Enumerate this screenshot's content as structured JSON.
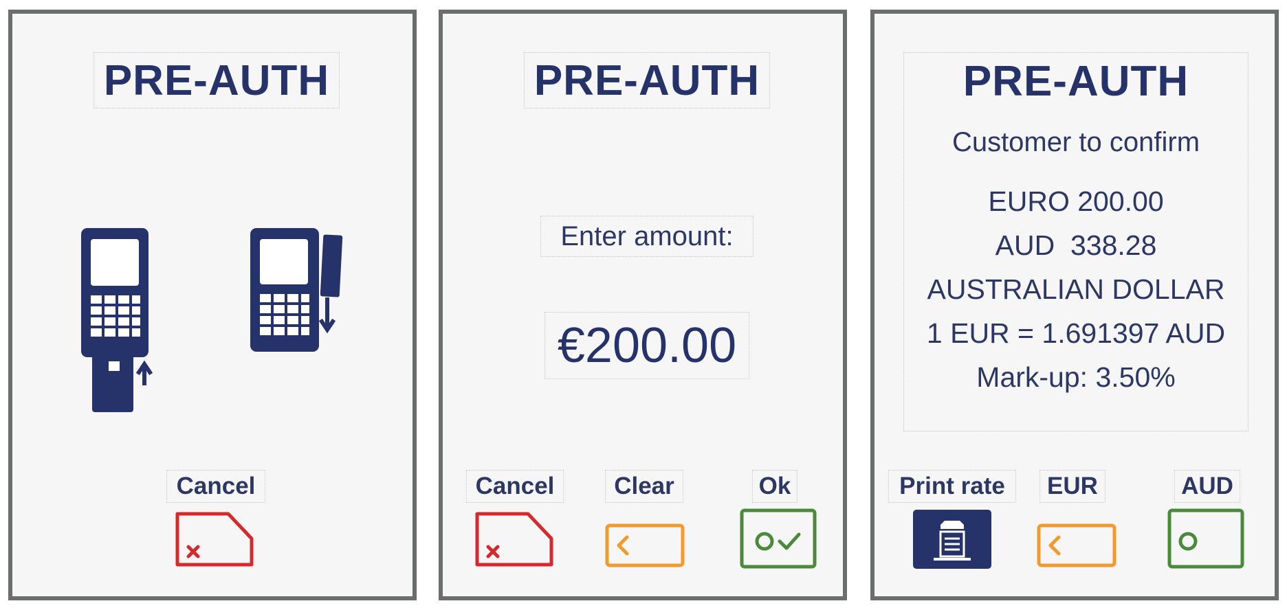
{
  "colors": {
    "navy": "#26336a",
    "frame": "#6b6f6c",
    "screen_bg": "#f6f6f6",
    "cancel_red": "#d42a2d",
    "clear_orange": "#f39a2c",
    "ok_green": "#4b8a3a"
  },
  "screens": [
    {
      "title": "PRE-AUTH",
      "illustration": [
        "terminal-card-insert-icon",
        "terminal-card-swipe-icon"
      ],
      "keys": [
        {
          "label": "Cancel",
          "icon": "cancel-key-icon"
        }
      ]
    },
    {
      "title": "PRE-AUTH",
      "prompt": "Enter amount:",
      "amount": "€200.00",
      "keys": [
        {
          "label": "Cancel",
          "icon": "cancel-key-icon"
        },
        {
          "label": "Clear",
          "icon": "clear-key-icon"
        },
        {
          "label": "Ok",
          "icon": "ok-key-icon"
        }
      ]
    },
    {
      "title": "PRE-AUTH",
      "subtitle": "Customer to confirm",
      "lines": [
        "EURO 200.00",
        "AUD  338.28",
        "AUSTRALIAN DOLLAR",
        "1 EUR = 1.691397 AUD",
        "Mark-up: 3.50%"
      ],
      "keys": [
        {
          "label": "Print rate",
          "icon": "printer-key-icon"
        },
        {
          "label": "EUR",
          "icon": "clear-key-icon"
        },
        {
          "label": "AUD",
          "icon": "ok-key-icon"
        }
      ]
    }
  ]
}
